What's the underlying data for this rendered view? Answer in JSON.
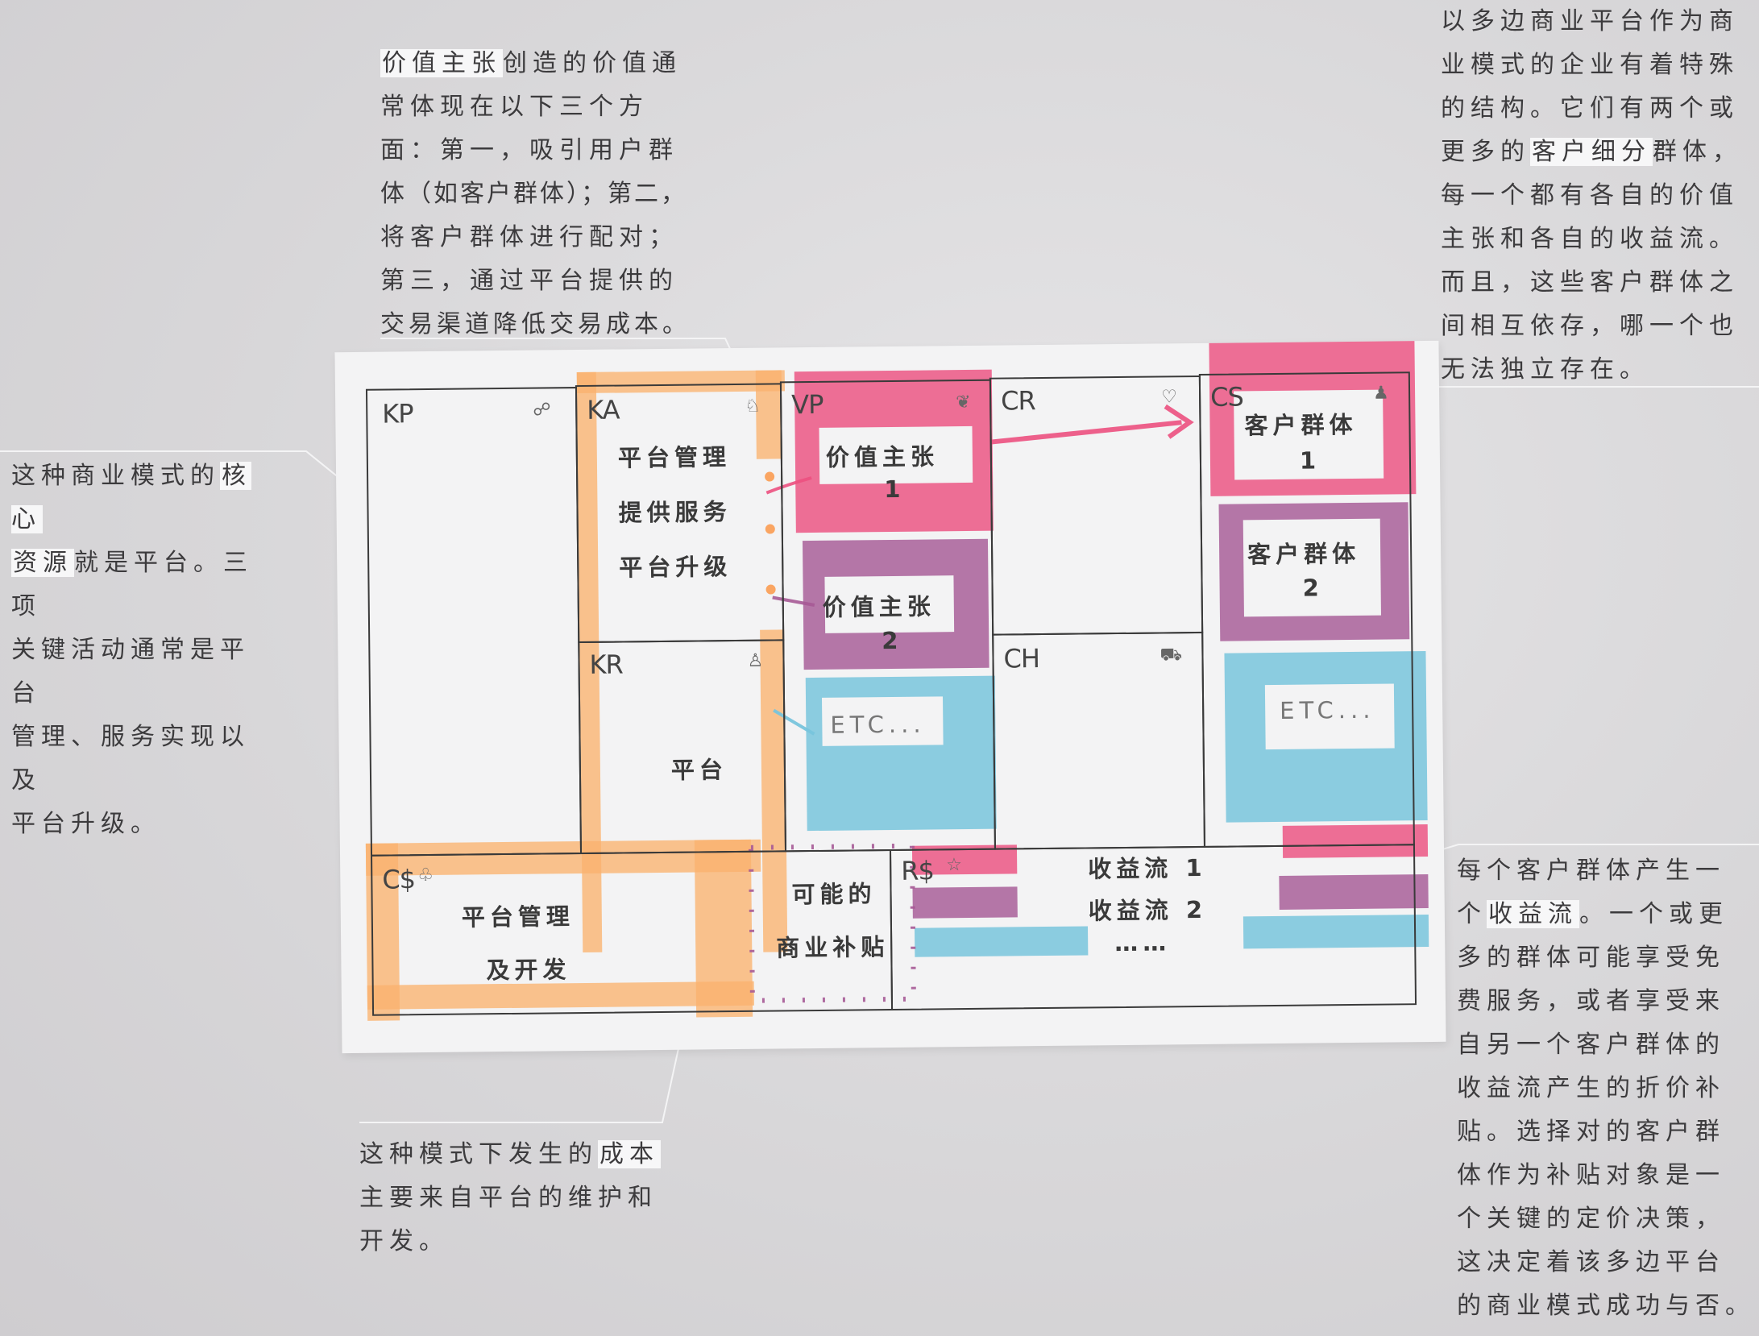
{
  "notes": {
    "value_proposition": {
      "highlight": "价值主张",
      "lines": [
        "创造的价值通",
        "常体现在以下三个方",
        "面：第一，吸引用户群",
        "体（如客户群体）；第二，",
        "将客户群体进行配对；",
        "第三，通过平台提供的",
        "交易渠道降低交易成本。"
      ]
    },
    "customer_segments": {
      "line1": "以多边商业平台作为商",
      "line2": "业模式的企业有着特殊",
      "line3": "的结构。它们有两个或",
      "line4_pre": "更多的",
      "line4_hl": "客户细分",
      "line4_post": "群体，",
      "line5": "每一个都有各自的价值",
      "line6": "主张和各自的收益流。",
      "line7": "而且，这些客户群体之",
      "line8": "间相互依存，哪一个也",
      "line9": "无法独立存在。"
    },
    "key_resources": {
      "line1_pre": "这种商业模式的",
      "line1_hl": "核心",
      "line2_hl": "资源",
      "line2_post": "就是平台。三项",
      "line3": "关键活动通常是平台",
      "line4": "管理、服务实现以及",
      "line5": "平台升级。"
    },
    "cost": {
      "line1_pre": "这种模式下发生的",
      "line1_hl": "成本",
      "line2": "主要来自平台的维护和",
      "line3": "开发。"
    },
    "revenue": {
      "line1": "每个客户群体产生一",
      "line2_pre": "个",
      "line2_hl": "收益流",
      "line2_post": "。一个或更",
      "line3": "多的群体可能享受免",
      "line4": "费服务，或者享受来",
      "line5": "自另一个客户群体的",
      "line6": "收益流产生的折价补",
      "line7": "贴。选择对的客户群",
      "line8": "体作为补贴对象是一",
      "line9": "个关键的定价决策，",
      "line10": "这决定着该多边平台",
      "line11": "的商业模式成功与否。"
    }
  },
  "canvas": {
    "codes": {
      "kp": "KP",
      "ka": "KA",
      "vp": "VP",
      "cr": "CR",
      "cs": "CS",
      "kr": "KR",
      "ch": "CH",
      "cost": "C$",
      "rev": "R$"
    },
    "ka_items": [
      "平台管理",
      "提供服务",
      "平台升级"
    ],
    "vp": {
      "label1": "价值主张",
      "num1": "1",
      "label2": "价值主张",
      "num2": "2",
      "etc": "ETC..."
    },
    "cs": {
      "label1": "客户群体",
      "num1": "1",
      "label2": "客户群体",
      "num2": "2",
      "etc": "ETC..."
    },
    "kr": {
      "label": "平台"
    },
    "cost": {
      "line1": "平台管理",
      "line2": "及开发",
      "sub1": "可能的",
      "sub2": "商业补贴"
    },
    "revenue": {
      "item1": "收益流 1",
      "item2": "收益流 2",
      "more": "……"
    }
  },
  "colors": {
    "orange": "#fab26e",
    "pink": "#ec5080",
    "purple": "#a65a96",
    "blue": "#78c4dc"
  }
}
